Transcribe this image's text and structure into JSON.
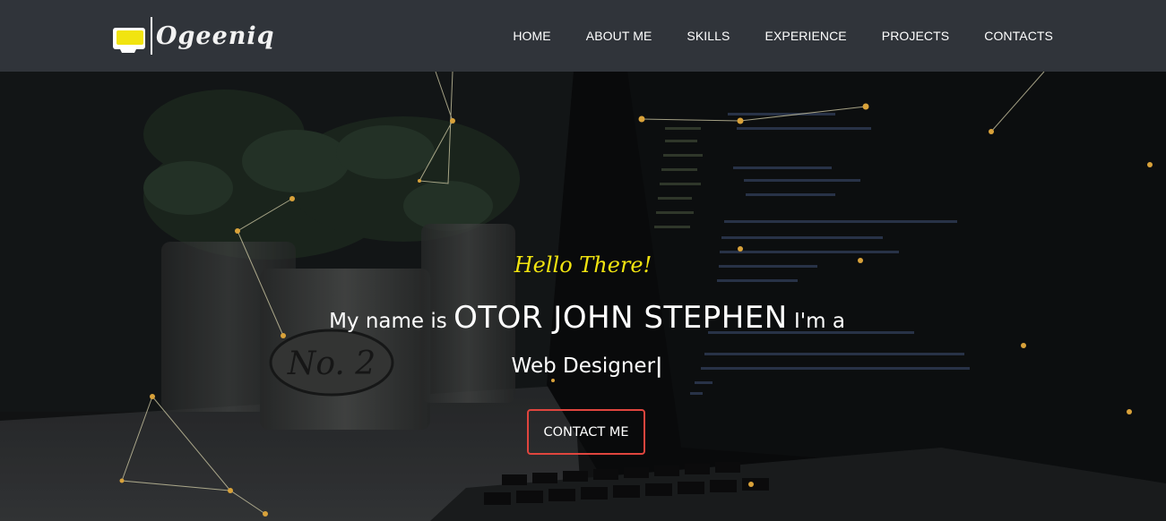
{
  "brand": {
    "logo_text": "Ogeeniq",
    "accent_color": "#f1e410",
    "icon": "monitor-logo-icon"
  },
  "nav": {
    "items": [
      {
        "label": "HOME"
      },
      {
        "label": "ABOUT ME"
      },
      {
        "label": "SKILLS"
      },
      {
        "label": "EXPERIENCE"
      },
      {
        "label": "PROJECTS"
      },
      {
        "label": "CONTACTS"
      }
    ]
  },
  "hero": {
    "greeting": "Hello There!",
    "intro": "My name is",
    "name": "OTOR JOHN STEPHEN",
    "role_prefix": "I'm a",
    "role": "Web Designer",
    "cursor": "|",
    "cta_label": "CONTACT ME",
    "cta_border_color": "#e0453e"
  },
  "colors": {
    "navbar_bg": "#30343a",
    "star": "#d9a23a"
  }
}
